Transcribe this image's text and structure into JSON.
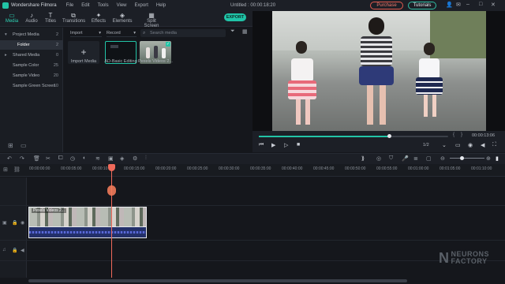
{
  "titlebar": {
    "app_name": "Wondershare Filmora",
    "menu": [
      "File",
      "Edit",
      "Tools",
      "View",
      "Export",
      "Help"
    ],
    "window_title": "Untitled : 00:00:18:20",
    "purchase_label": "Purchase",
    "tutorials_label": "Tutorials"
  },
  "tabs": [
    {
      "label": "Media",
      "icon": "folder-icon"
    },
    {
      "label": "Audio",
      "icon": "music-note-icon"
    },
    {
      "label": "Titles",
      "icon": "text-icon"
    },
    {
      "label": "Transitions",
      "icon": "transition-icon"
    },
    {
      "label": "Effects",
      "icon": "effects-icon"
    },
    {
      "label": "Elements",
      "icon": "elements-icon"
    },
    {
      "label": "Split Screen",
      "icon": "split-screen-icon"
    }
  ],
  "export_label": "EXPORT",
  "sidebar": {
    "items": [
      {
        "label": "Project Media",
        "count": "2"
      },
      {
        "label": "Folder",
        "count": "2"
      },
      {
        "label": "Shared Media",
        "count": "0"
      },
      {
        "label": "Sample Color",
        "count": "25"
      },
      {
        "label": "Sample Video",
        "count": "20"
      },
      {
        "label": "Sample Green Screen",
        "count": "10"
      }
    ]
  },
  "media": {
    "import_label": "Import",
    "record_label": "Record",
    "search_placeholder": "Search media",
    "items": [
      {
        "label": "Import Media"
      },
      {
        "label": "AD-Basic Editing"
      },
      {
        "label": "Pexels Videos 2..."
      }
    ]
  },
  "preview": {
    "timecode": "00:00:13:06",
    "ratio": "1/2"
  },
  "timeline": {
    "ruler": [
      "00:00:00:00",
      "00:00:05:00",
      "00:00:10:00",
      "00:00:15:00",
      "00:00:20:00",
      "00:00:25:00",
      "00:00:30:00",
      "00:00:35:00",
      "00:00:40:00",
      "00:00:45:00",
      "00:00:50:00",
      "00:00:55:00",
      "00:01:00:00",
      "00:01:05:00",
      "00:01:10:00"
    ],
    "clip_label": "Pexels Videos 2..."
  },
  "watermark": {
    "line1": "NEURONS",
    "line2": "FACTORY"
  },
  "colors": {
    "accent": "#22c3a6",
    "playhead": "#f06a5a",
    "purchase": "#e05a4e"
  }
}
